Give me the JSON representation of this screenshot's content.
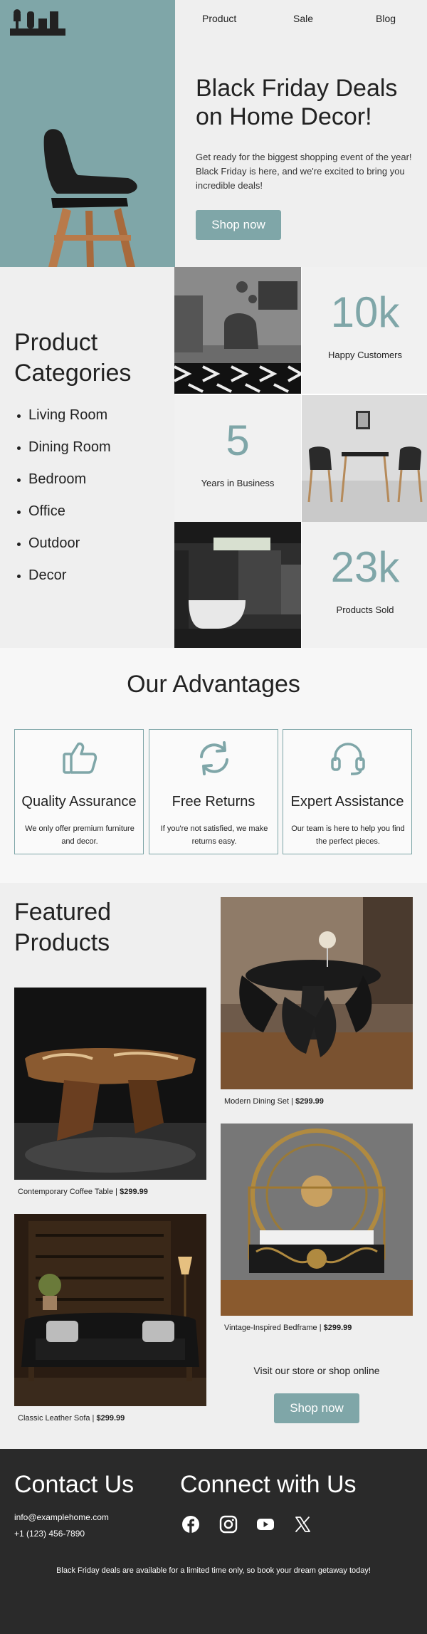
{
  "nav": {
    "items": [
      "Product",
      "Sale",
      "Blog"
    ]
  },
  "hero": {
    "title": "Black Friday Deals on Home Decor!",
    "text": "Get ready for the biggest shopping event of the year! Black Friday is here, and we're excited to bring you incredible deals!",
    "button": "Shop now"
  },
  "categories": {
    "title": "Product Categories",
    "items": [
      "Living Room",
      "Dining Room",
      "Bedroom",
      "Office",
      "Outdoor",
      "Decor"
    ]
  },
  "stats": [
    {
      "value": "10k",
      "label": "Happy Customers"
    },
    {
      "value": "5",
      "label": "Years in Business"
    },
    {
      "value": "23k",
      "label": "Products Sold"
    }
  ],
  "advantages": {
    "title": "Our Advantages",
    "cards": [
      {
        "name": "Quality Assurance",
        "desc": "We only offer premium furniture and decor.",
        "icon": "thumbs-up-icon"
      },
      {
        "name": "Free Returns",
        "desc": "If you're not satisfied, we make returns easy.",
        "icon": "refresh-icon"
      },
      {
        "name": "Expert Assistance",
        "desc": "Our team is here to help you find the perfect pieces.",
        "icon": "headset-icon"
      }
    ]
  },
  "featured": {
    "title": "Featured Products",
    "products": [
      {
        "name": "Modern Dining Set",
        "price": "$299.99"
      },
      {
        "name": "Contemporary Coffee Table",
        "price": "$299.99"
      },
      {
        "name": "Vintage-Inspired Bedframe",
        "price": "$299.99"
      },
      {
        "name": "Classic Leather Sofa",
        "price": "$299.99"
      }
    ],
    "visit_text": "Visit our store or shop online",
    "button": "Shop now"
  },
  "footer": {
    "contact_title": "Contact Us",
    "email": "info@examplehome.com",
    "phone": "+1 (123) 456-7890",
    "connect_title": "Connect with Us",
    "social_icons": [
      "facebook-icon",
      "instagram-icon",
      "youtube-icon",
      "x-icon"
    ],
    "note": "Black Friday deals are available for a limited time only, so book your dream getaway today!"
  },
  "colors": {
    "accent": "#7fa6a8",
    "panel": "#efefef",
    "footer": "#2a2a2a"
  }
}
